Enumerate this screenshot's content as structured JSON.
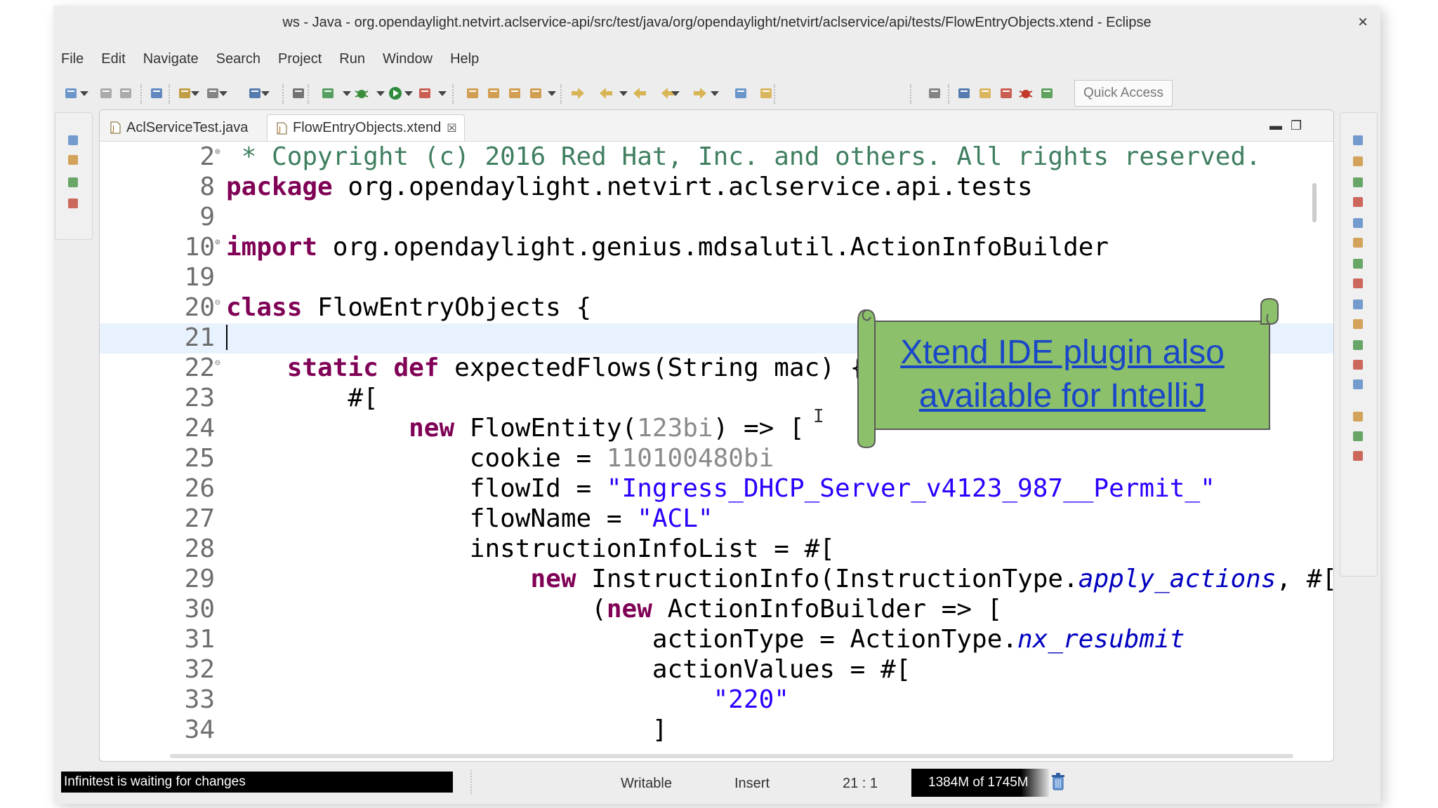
{
  "window": {
    "title": "ws - Java - org.opendaylight.netvirt.aclservice-api/src/test/java/org/opendaylight/netvirt/aclservice/api/tests/FlowEntryObjects.xtend - Eclipse",
    "close_glyph": "×"
  },
  "menu": [
    "File",
    "Edit",
    "Navigate",
    "Search",
    "Project",
    "Run",
    "Window",
    "Help"
  ],
  "toolbar": {
    "quick_access": "Quick Access",
    "icons": [
      "new-icon",
      "save-icon",
      "save-all-icon",
      "console-icon",
      "debug-config-icon",
      "link-icon",
      "outline-icon",
      "skip-breakpoints-icon",
      "coverage-icon",
      "debug-icon",
      "run-icon",
      "external-tools-icon",
      "new-java-project-icon",
      "new-package-icon",
      "new-class-icon",
      "open-type-icon",
      "next-annotation-icon",
      "previous-annotation-icon",
      "last-edit-icon",
      "back-icon",
      "forward-icon",
      "pin-editor-icon",
      "mark-icon",
      "open-perspective-icon",
      "java-perspective-icon",
      "java-ee-perspective-icon",
      "git-perspective-icon",
      "debug-perspective-icon",
      "plugin-perspective-icon"
    ]
  },
  "tabs": [
    {
      "label": "AclServiceTest.java",
      "active": false,
      "icon": "java-file-icon"
    },
    {
      "label": "FlowEntryObjects.xtend",
      "active": true,
      "icon": "xtend-file-icon",
      "close": "☒"
    }
  ],
  "editor": {
    "lines": [
      {
        "n": "2",
        "fold": "⊕",
        "tokens": [
          {
            "t": " * Copyright (c) 2016 Red Hat, Inc. and others. All rights reserved.",
            "c": "cmt"
          }
        ]
      },
      {
        "n": "8",
        "fold": "",
        "tokens": [
          {
            "t": "package",
            "c": "kw"
          },
          {
            "t": " org.opendaylight.netvirt.aclservice.api.tests",
            "c": ""
          }
        ]
      },
      {
        "n": "9",
        "fold": "",
        "tokens": []
      },
      {
        "n": "10",
        "fold": "⊕",
        "tokens": [
          {
            "t": "import",
            "c": "kw"
          },
          {
            "t": " org.opendaylight.genius.mdsalutil.ActionInfoBuilder",
            "c": ""
          }
        ]
      },
      {
        "n": "19",
        "fold": "",
        "tokens": []
      },
      {
        "n": "20",
        "fold": "⊖",
        "tokens": [
          {
            "t": "class",
            "c": "kw"
          },
          {
            "t": " FlowEntryObjects {",
            "c": ""
          }
        ]
      },
      {
        "n": "21",
        "fold": "",
        "tokens": [],
        "current": true
      },
      {
        "n": "22",
        "fold": "⊖",
        "tokens": [
          {
            "t": "    ",
            "c": ""
          },
          {
            "t": "static",
            "c": "kw"
          },
          {
            "t": " ",
            "c": ""
          },
          {
            "t": "def",
            "c": "kw"
          },
          {
            "t": " expectedFlows(String mac) {",
            "c": ""
          }
        ]
      },
      {
        "n": "23",
        "fold": "",
        "tokens": [
          {
            "t": "        #[",
            "c": ""
          }
        ]
      },
      {
        "n": "24",
        "fold": "",
        "tokens": [
          {
            "t": "            ",
            "c": ""
          },
          {
            "t": "new",
            "c": "kw"
          },
          {
            "t": " FlowEntity(",
            "c": ""
          },
          {
            "t": "123bi",
            "c": "num"
          },
          {
            "t": ") => [",
            "c": ""
          }
        ]
      },
      {
        "n": "25",
        "fold": "",
        "tokens": [
          {
            "t": "                cookie = ",
            "c": ""
          },
          {
            "t": "110100480bi",
            "c": "num"
          }
        ]
      },
      {
        "n": "26",
        "fold": "",
        "tokens": [
          {
            "t": "                flowId = ",
            "c": ""
          },
          {
            "t": "\"Ingress_DHCP_Server_v4123_987__Permit_\"",
            "c": "str"
          }
        ]
      },
      {
        "n": "27",
        "fold": "",
        "tokens": [
          {
            "t": "                flowName = ",
            "c": ""
          },
          {
            "t": "\"ACL\"",
            "c": "str"
          }
        ]
      },
      {
        "n": "28",
        "fold": "",
        "tokens": [
          {
            "t": "                instructionInfoList = #[",
            "c": ""
          }
        ]
      },
      {
        "n": "29",
        "fold": "",
        "tokens": [
          {
            "t": "                    ",
            "c": ""
          },
          {
            "t": "new",
            "c": "kw"
          },
          {
            "t": " InstructionInfo(InstructionType.",
            "c": ""
          },
          {
            "t": "apply_actions",
            "c": "it"
          },
          {
            "t": ", #[",
            "c": ""
          }
        ]
      },
      {
        "n": "30",
        "fold": "",
        "tokens": [
          {
            "t": "                        (",
            "c": ""
          },
          {
            "t": "new",
            "c": "kw"
          },
          {
            "t": " ActionInfoBuilder => [",
            "c": ""
          }
        ]
      },
      {
        "n": "31",
        "fold": "",
        "tokens": [
          {
            "t": "                            actionType = ActionType.",
            "c": ""
          },
          {
            "t": "nx_resubmit",
            "c": "it"
          }
        ]
      },
      {
        "n": "32",
        "fold": "",
        "tokens": [
          {
            "t": "                            actionValues = #[",
            "c": ""
          }
        ]
      },
      {
        "n": "33",
        "fold": "",
        "tokens": [
          {
            "t": "                                ",
            "c": ""
          },
          {
            "t": "\"220\"",
            "c": "str"
          }
        ]
      },
      {
        "n": "34",
        "fold": "",
        "tokens": [
          {
            "t": "                            ]",
            "c": ""
          }
        ]
      }
    ]
  },
  "callout": {
    "text": "Xtend IDE plugin also available for IntelliJ",
    "fill": "#8cc06a",
    "text_color": "#1a47c8"
  },
  "status": {
    "infinitest": "Infinitest is waiting for changes",
    "writable": "Writable",
    "insert_mode": "Insert",
    "position": "21 : 1",
    "heap": "1384M of 1745M"
  }
}
